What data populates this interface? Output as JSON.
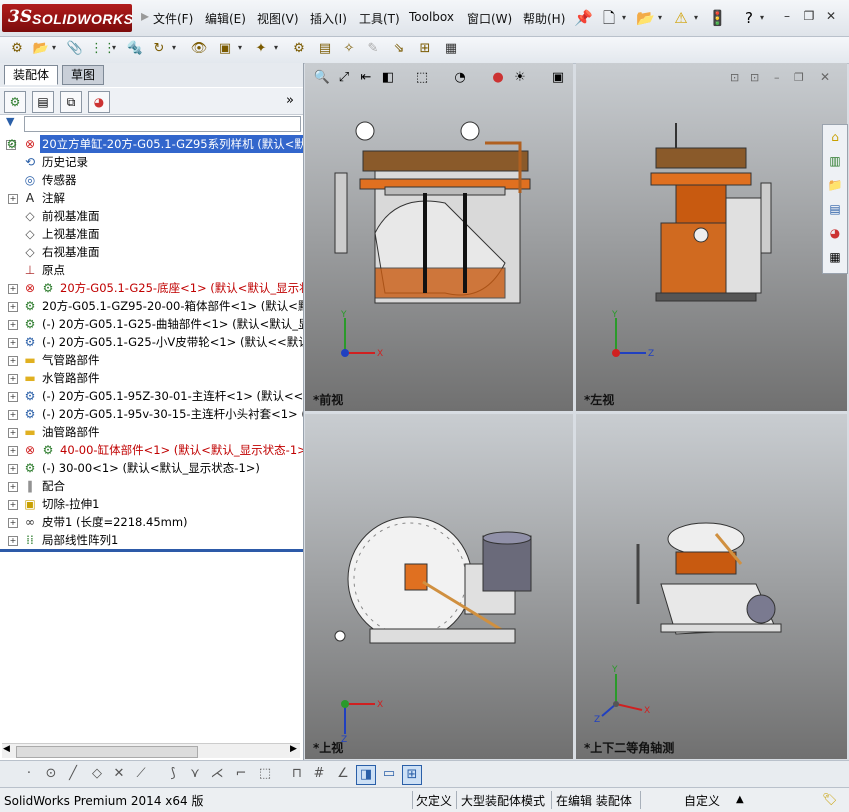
{
  "app": {
    "logo_ds": "3S",
    "logo_text": "SOLIDWORKS"
  },
  "menu": [
    "文件(F)",
    "编辑(E)",
    "视图(V)",
    "插入(I)",
    "工具(T)",
    "Toolbox",
    "窗口(W)",
    "帮助(H)"
  ],
  "panel": {
    "tabs": [
      "装配体",
      "草图"
    ],
    "expand_label": "»",
    "filter_icon": "▼"
  },
  "tree": [
    {
      "label": "20立方单缸-20方-G05.1-GZ95系列样机  (默认<默",
      "icon": "assembly-icon",
      "selected": true,
      "expander": "-",
      "indent": 0
    },
    {
      "label": "历史记录",
      "icon": "history-icon",
      "indent": 1
    },
    {
      "label": "传感器",
      "icon": "sensor-icon",
      "indent": 1
    },
    {
      "label": "注解",
      "icon": "annotation-icon",
      "expander": "+",
      "indent": 1
    },
    {
      "label": "前视基准面",
      "icon": "plane-icon",
      "indent": 1
    },
    {
      "label": "上视基准面",
      "icon": "plane-icon",
      "indent": 1
    },
    {
      "label": "右视基准面",
      "icon": "plane-icon",
      "indent": 1
    },
    {
      "label": "原点",
      "icon": "origin-icon",
      "indent": 1
    },
    {
      "label": "20方-G05.1-G25-底座<1> (默认<默认_显示状",
      "icon": "error-icon",
      "expander": "+",
      "indent": 1,
      "red": true
    },
    {
      "label": "20方-G05.1-GZ95-20-00-箱体部件<1> (默认<默认",
      "icon": "assembly-icon",
      "expander": "+",
      "indent": 1
    },
    {
      "label": "(-) 20方-G05.1-G25-曲轴部件<1> (默认<默认_显",
      "icon": "assembly-icon",
      "expander": "+",
      "indent": 1
    },
    {
      "label": "(-) 20方-G05.1-G25-小V皮带轮<1> (默认<<默认",
      "icon": "part-icon",
      "expander": "+",
      "indent": 1
    },
    {
      "label": "气管路部件",
      "icon": "folder-icon",
      "expander": "+",
      "indent": 1
    },
    {
      "label": "水管路部件",
      "icon": "folder-icon",
      "expander": "+",
      "indent": 1
    },
    {
      "label": "(-) 20方-G05.1-95Z-30-01-主连杆<1> (默认<<默",
      "icon": "part-icon",
      "expander": "+",
      "indent": 1
    },
    {
      "label": "(-) 20方-G05.1-95v-30-15-主连杆小头衬套<1> (",
      "icon": "part-icon",
      "expander": "+",
      "indent": 1
    },
    {
      "label": "油管路部件",
      "icon": "folder-icon",
      "expander": "+",
      "indent": 1
    },
    {
      "label": "40-00-缸体部件<1> (默认<默认_显示状态-1>",
      "icon": "error-icon",
      "expander": "+",
      "indent": 1,
      "red": true
    },
    {
      "label": "(-) 30-00<1> (默认<默认_显示状态-1>)",
      "icon": "assembly-icon",
      "expander": "+",
      "indent": 1
    },
    {
      "label": "配合",
      "icon": "mates-icon",
      "expander": "+",
      "indent": 1
    },
    {
      "label": "切除-拉伸1",
      "icon": "cut-extrude-icon",
      "expander": "+",
      "indent": 1
    },
    {
      "label": "皮带1 (长度=2218.45mm)",
      "icon": "belt-icon",
      "expander": "+",
      "indent": 1
    },
    {
      "label": "局部线性阵列1",
      "icon": "pattern-icon",
      "expander": "+",
      "indent": 1
    }
  ],
  "viewports": {
    "front": "*前视",
    "left": "*左视",
    "top": "*上视",
    "iso": "*上下二等角轴测"
  },
  "axis_labels": {
    "x": "X",
    "y": "Y",
    "z": "Z"
  },
  "status": {
    "product": "SolidWorks Premium 2014 x64 版",
    "underdefined": "欠定义",
    "large_assembly": "大型装配体模式",
    "editing": "在编辑 装配体",
    "custom": "自定义"
  },
  "colors": {
    "selection": "#3266cc",
    "error_text": "#c00000",
    "brand": "#b01c1c"
  }
}
